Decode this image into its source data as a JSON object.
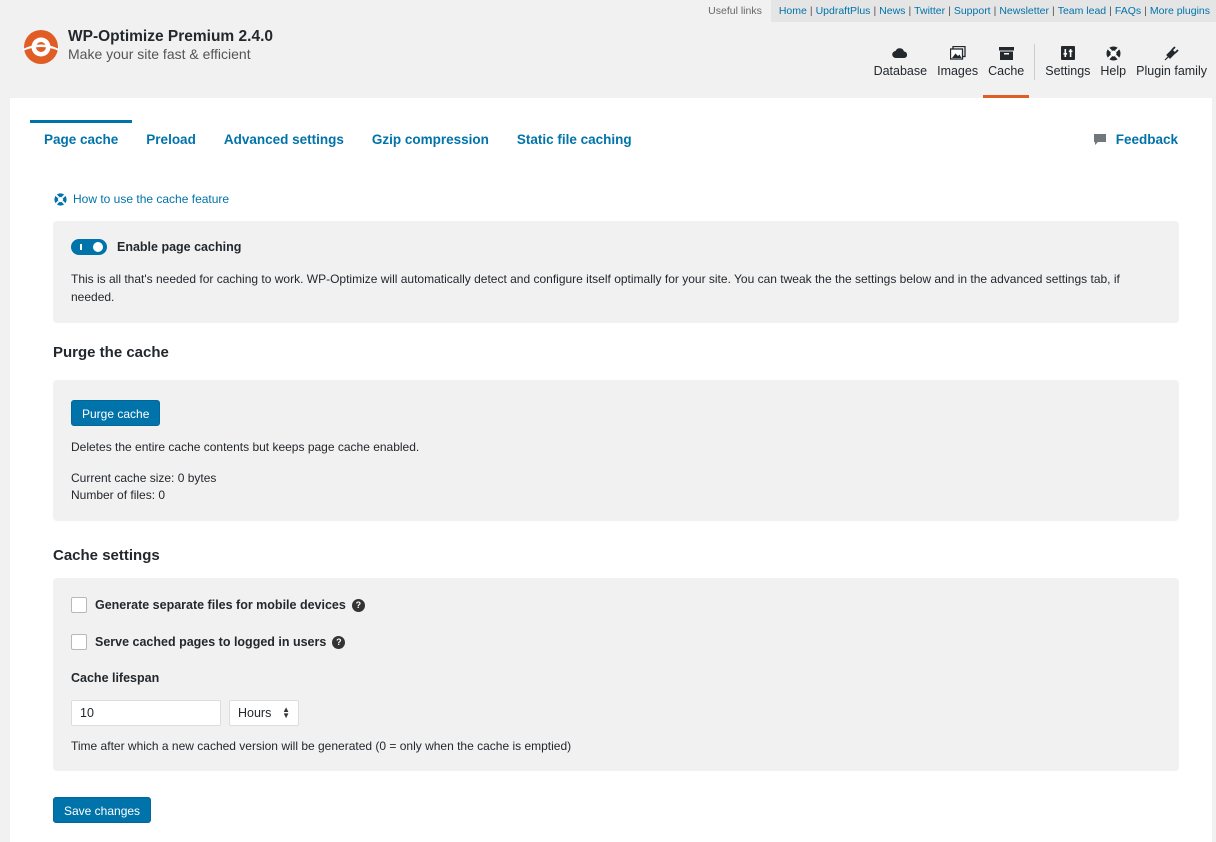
{
  "useful_links": {
    "label": "Useful links",
    "links": [
      "Home",
      "UpdraftPlus",
      "News",
      "Twitter",
      "Support",
      "Newsletter",
      "Team lead",
      "FAQs",
      "More plugins"
    ],
    "separator": "|"
  },
  "brand": {
    "title": "WP-Optimize Premium 2.4.0",
    "subtitle": "Make your site fast & efficient",
    "accent_color": "#e05d26"
  },
  "main_nav": [
    {
      "label": "Database",
      "icon": "cloud-icon"
    },
    {
      "label": "Images",
      "icon": "images-icon"
    },
    {
      "label": "Cache",
      "icon": "archive-icon",
      "active": true
    },
    {
      "label": "Settings",
      "icon": "settings-icon"
    },
    {
      "label": "Help",
      "icon": "lifebuoy-icon"
    },
    {
      "label": "Plugin family",
      "icon": "plugin-icon"
    }
  ],
  "tabs": {
    "items": [
      "Page cache",
      "Preload",
      "Advanced settings",
      "Gzip compression",
      "Static file caching"
    ],
    "active": "Page cache",
    "feedback": "Feedback"
  },
  "howto_link": "How to use the cache feature",
  "enable_section": {
    "toggle_label": "Enable page caching",
    "toggle_on": true,
    "description": "This is all that's needed for caching to work. WP-Optimize will automatically detect and configure itself optimally for your site. You can tweak the the settings below and in the advanced settings tab, if needed."
  },
  "purge_section": {
    "title": "Purge the cache",
    "button": "Purge cache",
    "description": "Deletes the entire cache contents but keeps page cache enabled.",
    "cache_size": "Current cache size: 0 bytes",
    "file_count": "Number of files: 0"
  },
  "cache_settings": {
    "title": "Cache settings",
    "mobile_label": "Generate separate files for mobile devices",
    "mobile_checked": false,
    "logged_in_label": "Serve cached pages to logged in users",
    "logged_in_checked": false,
    "lifespan_label": "Cache lifespan",
    "lifespan_value": "10",
    "lifespan_unit": "Hours",
    "lifespan_help": "Time after which a new cached version will be generated (0 = only when the cache is emptied)"
  },
  "save_button": "Save changes",
  "colors": {
    "link": "#0073aa",
    "button": "#0073aa",
    "background": "#f1f1f1"
  }
}
